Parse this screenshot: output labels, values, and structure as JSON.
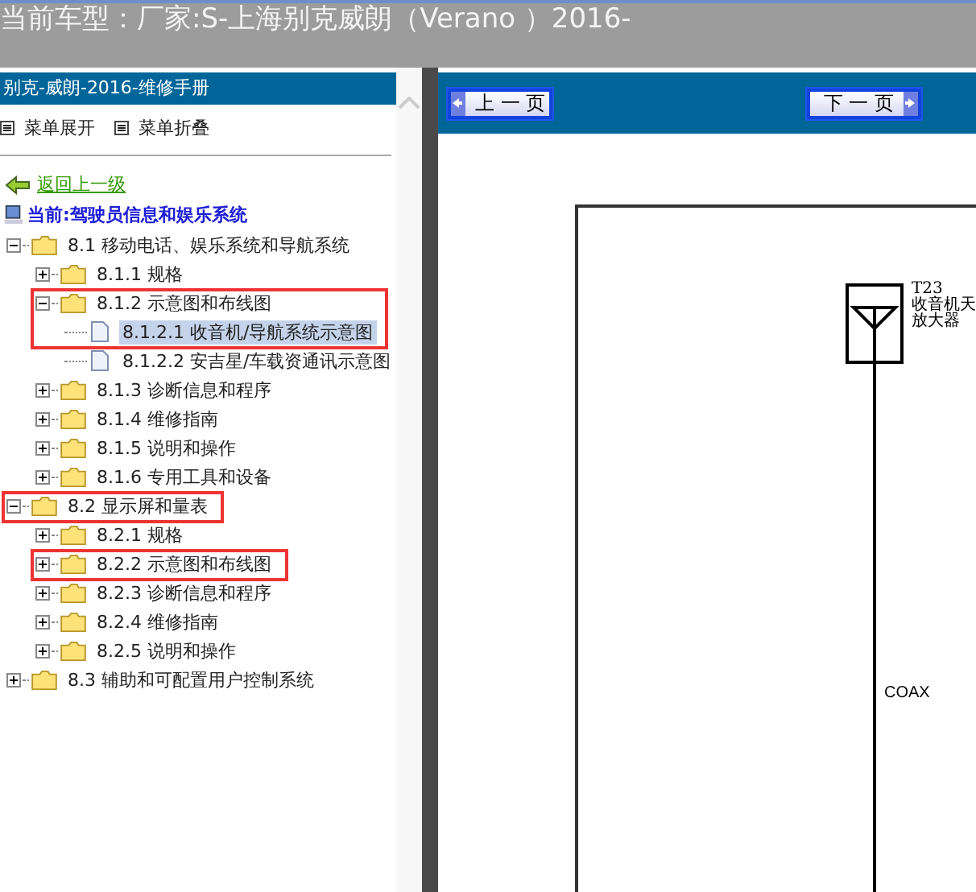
{
  "header": {
    "title": "当前车型：厂家:S-上海别克威朗（Verano ）2016-"
  },
  "sidebar": {
    "title": "别克-威朗-2016-维修手册",
    "menu_actions": [
      {
        "label": "菜单展开"
      },
      {
        "label": "菜单折叠"
      }
    ],
    "back_link": "返回上一级",
    "current": "当前:驾驶员信息和娱乐系统",
    "tree": [
      {
        "label": "8.1 移动电话、娱乐系统和导航系统",
        "kind": "folder",
        "expanded": true,
        "selected": false,
        "highlighted": false,
        "children": [
          {
            "label": "8.1.1 规格",
            "kind": "folder",
            "expanded": false,
            "selected": false,
            "highlighted": false
          },
          {
            "label": "8.1.2 示意图和布线图",
            "kind": "folder",
            "expanded": true,
            "selected": false,
            "highlighted": true,
            "children": [
              {
                "label": "8.1.2.1 收音机/导航系统示意图",
                "kind": "page",
                "selected": true,
                "highlighted": false
              },
              {
                "label": "8.1.2.2 安吉星/车载资通讯示意图",
                "kind": "page",
                "selected": false,
                "highlighted": false
              }
            ]
          },
          {
            "label": "8.1.3 诊断信息和程序",
            "kind": "folder",
            "expanded": false,
            "selected": false,
            "highlighted": false
          },
          {
            "label": "8.1.4 维修指南",
            "kind": "folder",
            "expanded": false,
            "selected": false,
            "highlighted": false
          },
          {
            "label": "8.1.5 说明和操作",
            "kind": "folder",
            "expanded": false,
            "selected": false,
            "highlighted": false
          },
          {
            "label": "8.1.6 专用工具和设备",
            "kind": "folder",
            "expanded": false,
            "selected": false,
            "highlighted": false
          }
        ]
      },
      {
        "label": "8.2 显示屏和量表",
        "kind": "folder",
        "expanded": true,
        "selected": false,
        "highlighted": true,
        "children": [
          {
            "label": "8.2.1 规格",
            "kind": "folder",
            "expanded": false,
            "selected": false,
            "highlighted": false
          },
          {
            "label": "8.2.2 示意图和布线图",
            "kind": "folder",
            "expanded": false,
            "selected": false,
            "highlighted": true
          },
          {
            "label": "8.2.3 诊断信息和程序",
            "kind": "folder",
            "expanded": false,
            "selected": false,
            "highlighted": false
          },
          {
            "label": "8.2.4 维修指南",
            "kind": "folder",
            "expanded": false,
            "selected": false,
            "highlighted": false
          },
          {
            "label": "8.2.5 说明和操作",
            "kind": "folder",
            "expanded": false,
            "selected": false,
            "highlighted": false
          }
        ]
      },
      {
        "label": "8.3 辅助和可配置用户控制系统",
        "kind": "folder",
        "expanded": false,
        "selected": false,
        "highlighted": false
      }
    ]
  },
  "toolbar": {
    "prev_button": "上 一 页",
    "next_button": "下 一 页"
  },
  "diagram": {
    "component_id": "T23",
    "component_name_lines": [
      "收音机天",
      "放大器"
    ],
    "wire_label": "COAX"
  }
}
